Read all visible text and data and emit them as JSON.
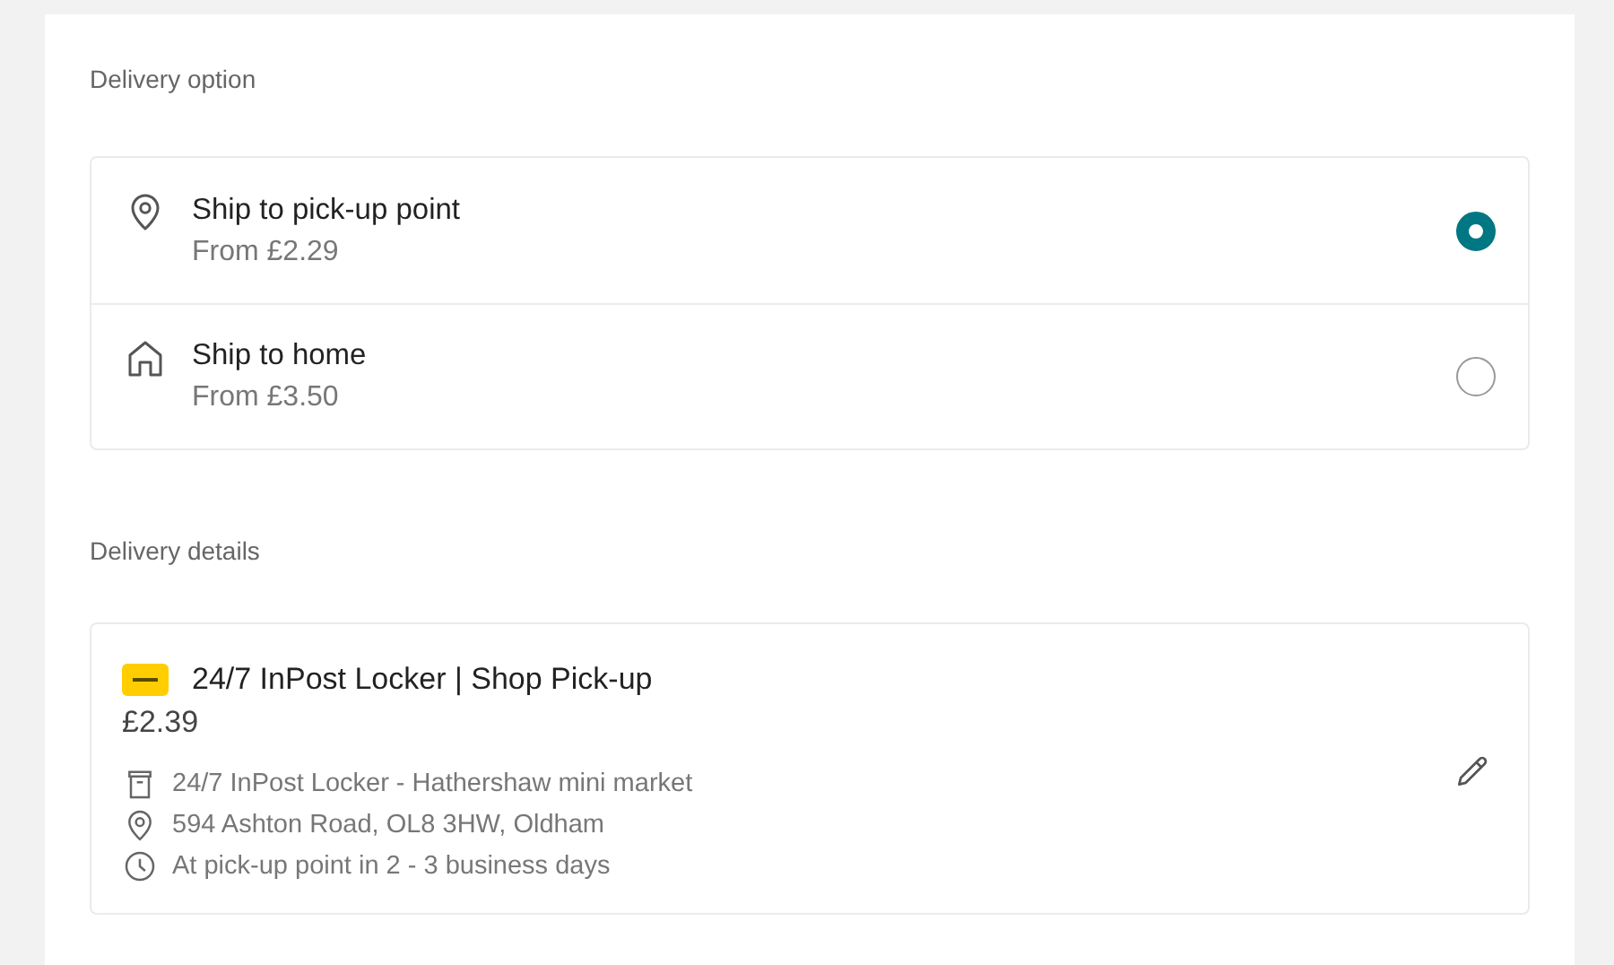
{
  "delivery_option": {
    "heading": "Delivery option",
    "options": [
      {
        "kind": "pin",
        "title": "Ship to pick-up point",
        "price": "From £2.29",
        "selected": true
      },
      {
        "kind": "home",
        "title": "Ship to home",
        "price": "From £3.50",
        "selected": false
      }
    ]
  },
  "delivery_details": {
    "heading": "Delivery details",
    "title": "24/7 InPost Locker | Shop Pick-up",
    "price": "£2.39",
    "lines": [
      {
        "kind": "locker",
        "text": "24/7 InPost Locker - Hathershaw mini market"
      },
      {
        "kind": "pin",
        "text": "594 Ashton Road, OL8 3HW, Oldham"
      },
      {
        "kind": "clock",
        "text": "At pick-up point in 2 - 3 business days"
      }
    ]
  }
}
